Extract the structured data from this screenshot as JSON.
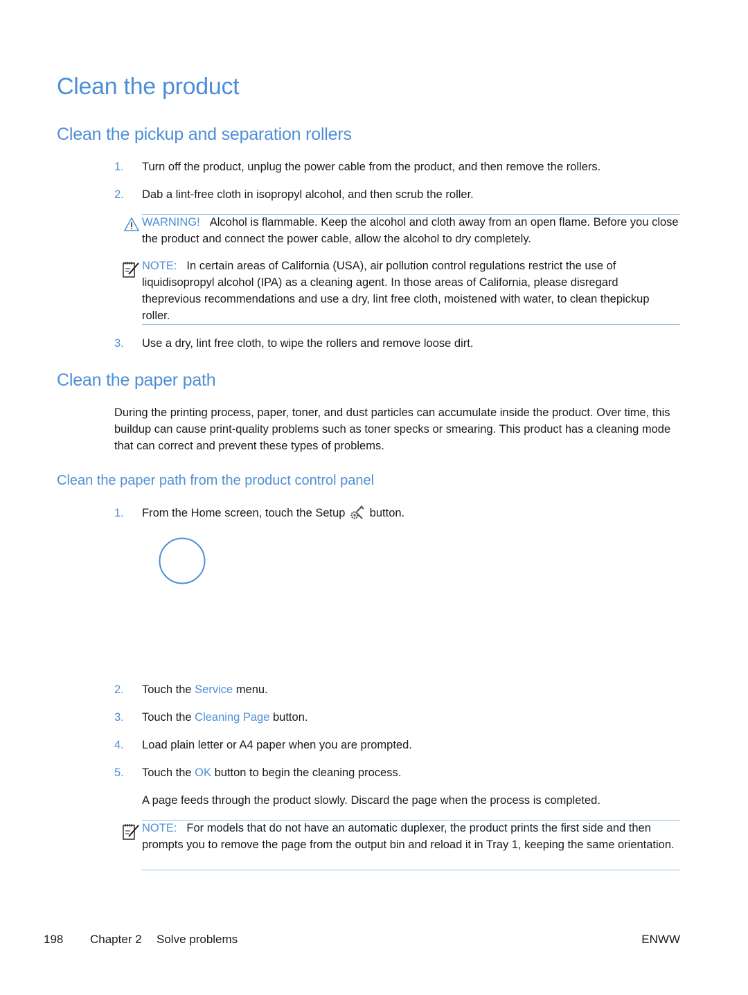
{
  "page_title": "Clean the product",
  "section1": {
    "heading": "Clean the pickup and separation rollers",
    "steps": [
      {
        "num": "1.",
        "text": "Turn off the product, unplug the power cable from the product, and then remove the rollers."
      },
      {
        "num": "2.",
        "text": "Dab a lint-free cloth in isopropyl alcohol, and then scrub the roller."
      }
    ],
    "warning": {
      "label": "WARNING!",
      "text": "Alcohol is flammable. Keep the alcohol and cloth away from an open flame. Before you close the product and connect the power cable, allow the alcohol to dry completely."
    },
    "note": {
      "label": "NOTE:",
      "text": "In certain areas of California (USA), air pollution control regulations restrict the use of liquidisopropyl alcohol (IPA) as a cleaning agent. In those areas of California, please disregard theprevious recommendations and use a dry, lint free cloth, moistened with water, to clean thepickup roller."
    },
    "step3": {
      "num": "3.",
      "text": "Use a dry, lint free cloth, to wipe the rollers and remove loose dirt."
    }
  },
  "section2": {
    "heading": "Clean the paper path",
    "intro": "During the printing process, paper, toner, and dust particles can accumulate inside the product. Over time, this buildup can cause print-quality problems such as toner specks or smearing. This product has a cleaning mode that can correct and prevent these types of problems.",
    "subheading": "Clean the paper path from the product control panel",
    "step1": {
      "num": "1.",
      "before": "From the Home screen, touch the Setup",
      "after": "button."
    },
    "step2": {
      "num": "2.",
      "before": "Touch the",
      "link": "Service",
      "after": "menu."
    },
    "step3": {
      "num": "3.",
      "before": "Touch the",
      "link": "Cleaning Page",
      "after": "button."
    },
    "step4": {
      "num": "4.",
      "text": "Load plain letter or A4 paper when you are prompted."
    },
    "step5": {
      "num": "5.",
      "before": "Touch the",
      "link": "OK",
      "after": "button to begin the cleaning process."
    },
    "result": "A page feeds through the product slowly. Discard the page when the process is completed.",
    "note": {
      "label": "NOTE:",
      "text": "For models that do not have an automatic duplexer, the product prints the first side and then prompts you to remove the page from the output bin and reload it in Tray 1, keeping the same orientation."
    }
  },
  "footer": {
    "page_number": "198",
    "chapter": "Chapter 2",
    "chapter_title": "Solve problems",
    "edition": "ENWW"
  },
  "icons": {
    "warning": "warning-triangle-icon",
    "note": "note-pencil-icon",
    "setup": "setup-wrench-gear-icon"
  }
}
